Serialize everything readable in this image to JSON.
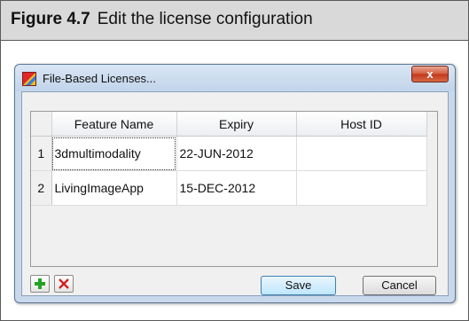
{
  "figure": {
    "label": "Figure 4.7",
    "title": "Edit the license configuration"
  },
  "dialog": {
    "title": "File-Based Licenses...",
    "close_label": "x",
    "table": {
      "columns": [
        "Feature Name",
        "Expiry",
        "Host ID"
      ],
      "rows": [
        {
          "num": "1",
          "feature": "3dmultimodality",
          "expiry": "22-JUN-2012",
          "host_id": ""
        },
        {
          "num": "2",
          "feature": "LivingImageApp",
          "expiry": "15-DEC-2012",
          "host_id": ""
        }
      ]
    },
    "buttons": {
      "add_icon": "plus-icon",
      "remove_icon": "x-icon",
      "save_label": "Save",
      "cancel_label": "Cancel"
    }
  },
  "colors": {
    "add_green": "#23a323",
    "remove_red": "#d42020",
    "close_red": "#c2361a",
    "dialog_frame": "#c9d9ec"
  }
}
